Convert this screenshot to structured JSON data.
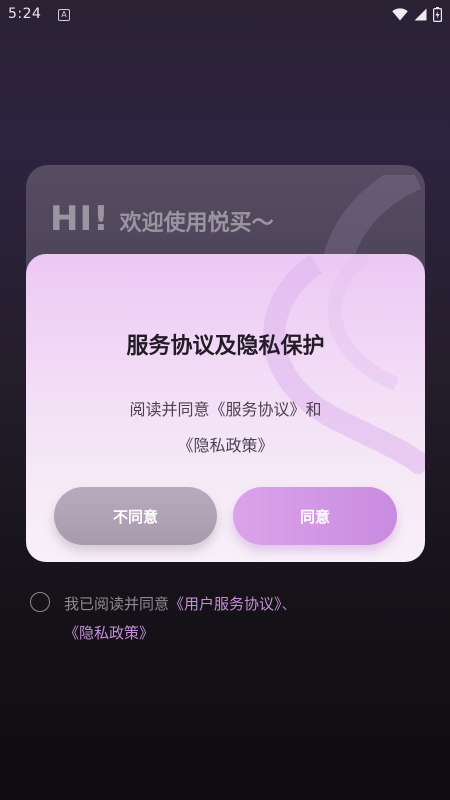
{
  "status_bar": {
    "time": "5:24",
    "a_icon": "A",
    "icons": [
      "wifi-icon",
      "signal-icon",
      "battery-icon"
    ]
  },
  "welcome": {
    "hi": "HI!",
    "text": "欢迎使用悦买～"
  },
  "dialog": {
    "title": "服务协议及隐私保护",
    "body_line1": "阅读并同意《服务协议》和",
    "body_line2": "《隐私政策》",
    "disagree_label": "不同意",
    "agree_label": "同意"
  },
  "agreement": {
    "prefix": "我已阅读并同意",
    "link1": "《用户服务协议》",
    "separator": "、",
    "link2": "《隐私政策》"
  },
  "colors": {
    "accent": "#c98be0",
    "link": "#c48fd6",
    "disagree": "#b3a4b7"
  }
}
